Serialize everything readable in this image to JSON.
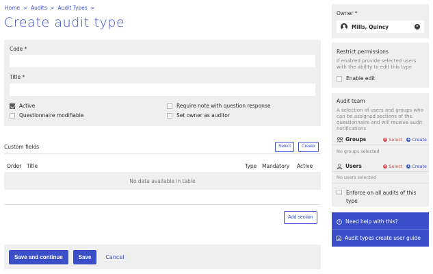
{
  "breadcrumb": {
    "items": [
      "Home",
      "Audits",
      "Audit Types"
    ],
    "separator": ">"
  },
  "page_title": "Create audit type",
  "form": {
    "code_label": "Code *",
    "code_value": "",
    "title_label": "Title *",
    "title_value": "",
    "checkboxes": [
      {
        "label": "Active",
        "checked": true
      },
      {
        "label": "Require note with question response",
        "checked": false
      },
      {
        "label": "Questionnaire modifiable",
        "checked": false
      },
      {
        "label": "Set owner as auditor",
        "checked": false
      }
    ]
  },
  "custom_fields": {
    "title": "Custom fields",
    "select_label": "Select",
    "create_label": "Create",
    "columns": [
      "Order",
      "Title",
      "Type",
      "Mandatory",
      "Active"
    ],
    "empty_message": "No data available in table",
    "add_section_label": "Add section"
  },
  "actions": {
    "save_continue_label": "Save and continue",
    "save_label": "Save",
    "cancel_label": "Cancel"
  },
  "owner": {
    "label": "Owner *",
    "value": "Mills, Quincy"
  },
  "permissions": {
    "title": "Restrict permissions",
    "description": "If enabled provide selected users with the ability to edit this type",
    "enable_label": "Enable edit",
    "enabled": false
  },
  "audit_team": {
    "title": "Audit team",
    "description": "A selection of users and groups who can be assigned sections of the questionnaire and will receive audit notifications",
    "groups_label": "Groups",
    "groups_empty": "No groups selected",
    "users_label": "Users",
    "users_empty": "No users selected",
    "select_label": "Select",
    "create_label": "Create",
    "enforce_label": "Enforce on all audits of this type",
    "enforce_checked": false
  },
  "help": {
    "need_help_label": "Need help with this?",
    "guide_label": "Audit types create user guide"
  },
  "colors": {
    "accent": "#3b4fc9",
    "danger": "#e04848",
    "panel": "#efefef"
  }
}
